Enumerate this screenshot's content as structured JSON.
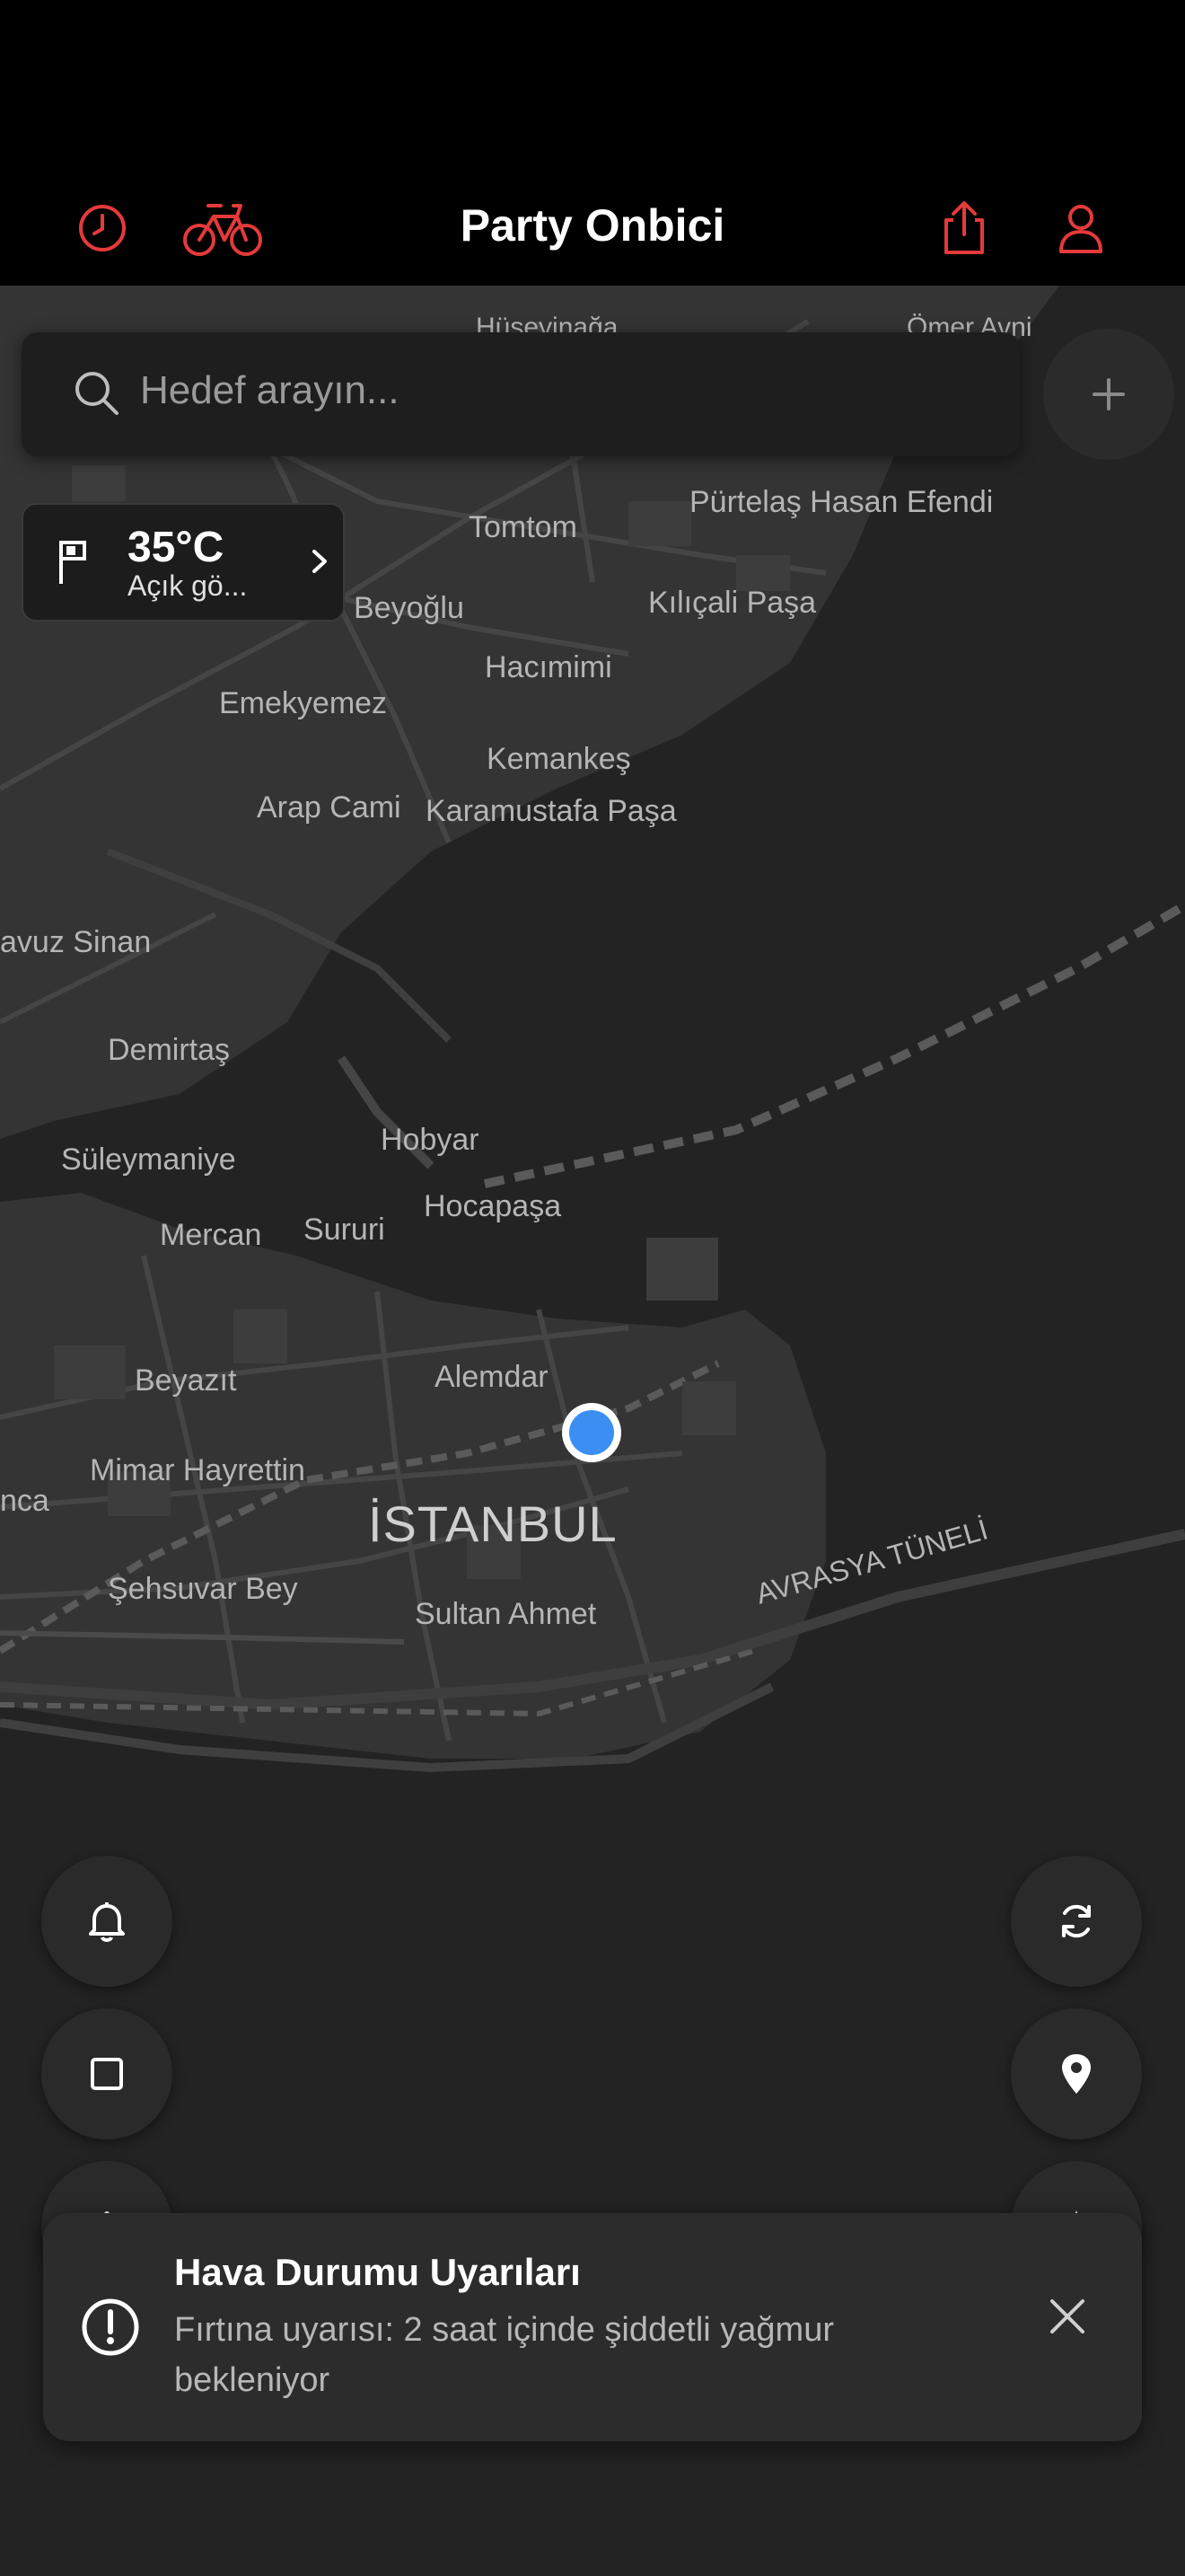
{
  "header": {
    "title": "Party Onbici",
    "accent_color": "#e53a3a",
    "left_icons": [
      "clock-icon",
      "bicycle-icon"
    ],
    "right_icons": [
      "share-icon",
      "profile-icon"
    ]
  },
  "search": {
    "placeholder": "Hedef arayın...",
    "icon": "search-icon",
    "add_icon": "plus-icon"
  },
  "weather": {
    "temperature": "35°C",
    "description": "Açık gö...",
    "icon": "flag-icon"
  },
  "map": {
    "labels": {
      "huseyinaga": "Hüseyinağa",
      "omer_avni": "Ömer Avni",
      "tomtom": "Tomtom",
      "purtelas": "Pürtelaş Hasan Efendi",
      "beyoglu": "Beyoğlu",
      "kilicali": "Kılıçali Paşa",
      "hacimimi": "Hacımimi",
      "emekyemez": "Emekyemez",
      "kemankes": "Kemankeş",
      "arap_cami": "Arap Cami",
      "karamustafa": "Karamustafa Paşa",
      "yavuz_sinan": "avuz Sinan",
      "demirtas": "Demirtaş",
      "hobyar": "Hobyar",
      "suleymaniye": "Süleymaniye",
      "hocapasa": "Hocapaşa",
      "mercan": "Mercan",
      "sururi": "Sururi",
      "beyazit": "Beyazıt",
      "alemdar": "Alemdar",
      "mimar": "Mimar Hayrettin",
      "nca": "nca",
      "istanbul": "İSTANBUL",
      "sehsuvar": "Şehsuvar Bey",
      "sultan_ahmet": "Sultan Ahmet",
      "avrasya": "AVRASYA TÜNELİ"
    }
  },
  "controls": {
    "left": [
      "bell-icon",
      "square-icon",
      "info-icon"
    ],
    "right": [
      "refresh-icon",
      "location-pin-icon",
      "navigation-icon"
    ]
  },
  "alert": {
    "title": "Hava Durumu Uyarıları",
    "message": "Fırtına uyarısı: 2 saat içinde şiddetli yağmur bekleniyor",
    "icon": "exclamation-circle-icon",
    "close_icon": "close-icon"
  }
}
